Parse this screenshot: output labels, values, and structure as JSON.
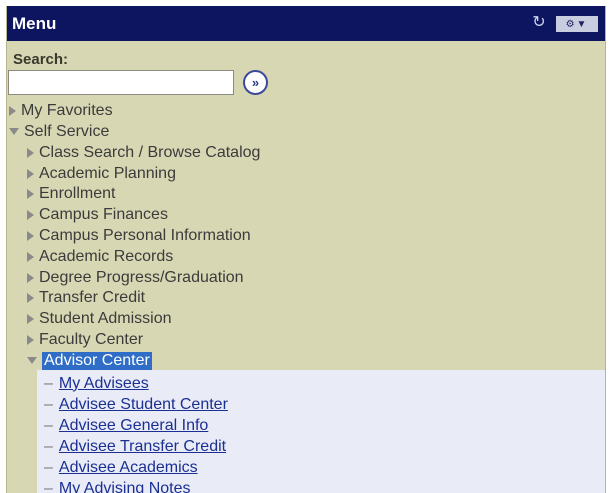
{
  "header": {
    "title": "Menu",
    "refresh_icon": "refresh-icon",
    "options_icon": "gear-dropdown-icon"
  },
  "search": {
    "label": "Search:",
    "value": "",
    "placeholder": "",
    "go_glyph": "»"
  },
  "menu": {
    "my_favorites": "My Favorites",
    "self_service": "Self Service",
    "items": [
      "Class Search / Browse Catalog",
      "Academic Planning",
      "Enrollment",
      "Campus Finances",
      "Campus Personal Information",
      "Academic Records",
      "Degree Progress/Graduation",
      "Transfer Credit",
      "Student Admission",
      "Faculty Center"
    ],
    "advisor_center": "Advisor Center",
    "advisor_links": [
      "My Advisees",
      "Advisee Student Center",
      "Advisee General Info",
      "Advisee Transfer Credit",
      "Advisee Academics",
      "My Advising Notes"
    ]
  },
  "colors": {
    "titlebar": "#0d1560",
    "panel": "#d8d7b4",
    "selected": "#2f6dc6",
    "link": "#1b2f93"
  }
}
